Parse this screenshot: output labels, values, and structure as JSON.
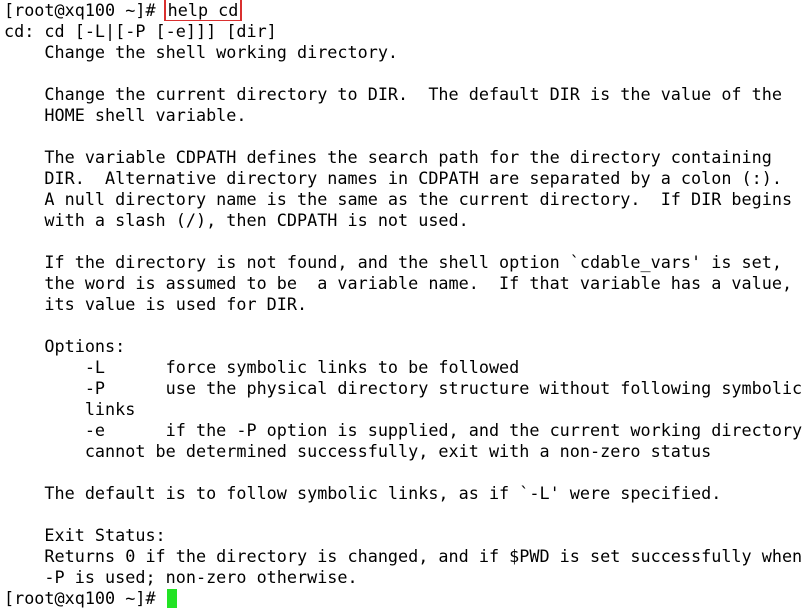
{
  "terminal": {
    "prompt": "[root@xq100 ~]# ",
    "command": "help cd",
    "output_lines": [
      "cd: cd [-L|[-P [-e]]] [dir]",
      "    Change the shell working directory.",
      "",
      "    Change the current directory to DIR.  The default DIR is the value of the",
      "    HOME shell variable.",
      "",
      "    The variable CDPATH defines the search path for the directory containing",
      "    DIR.  Alternative directory names in CDPATH are separated by a colon (:).",
      "    A null directory name is the same as the current directory.  If DIR begins",
      "    with a slash (/), then CDPATH is not used.",
      "",
      "    If the directory is not found, and the shell option `cdable_vars' is set,",
      "    the word is assumed to be  a variable name.  If that variable has a value,",
      "    its value is used for DIR.",
      "",
      "    Options:",
      "        -L      force symbolic links to be followed",
      "        -P      use the physical directory structure without following symbolic",
      "        links",
      "        -e      if the -P option is supplied, and the current working directory",
      "        cannot be determined successfully, exit with a non-zero status",
      "",
      "    The default is to follow symbolic links, as if `-L' were specified.",
      "",
      "    Exit Status:",
      "    Returns 0 if the directory is changed, and if $PWD is set successfully when",
      "    -P is used; non-zero otherwise."
    ],
    "final_prompt": "[root@xq100 ~]# ",
    "colors": {
      "background": "#ffffff",
      "text": "#000000",
      "highlight_box": "#d9302f",
      "cursor": "#22e324"
    }
  }
}
